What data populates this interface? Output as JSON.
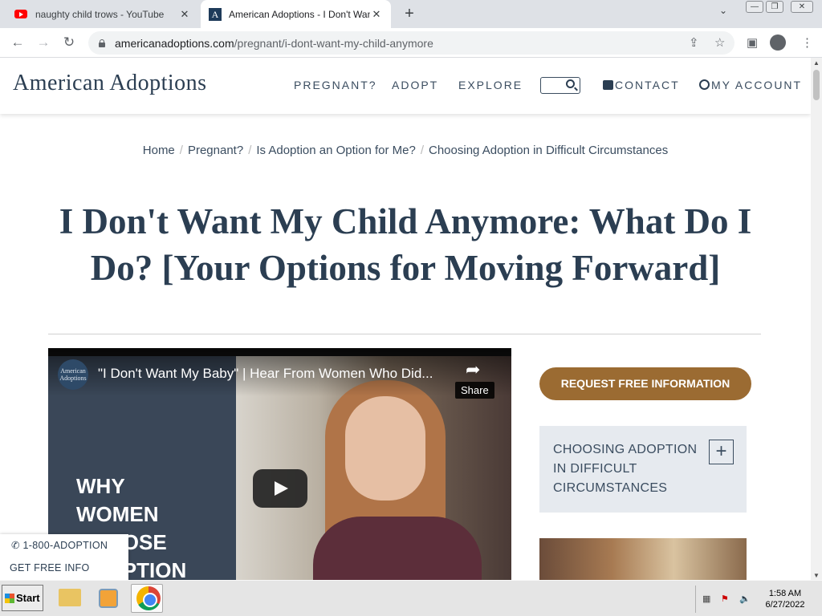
{
  "browser": {
    "tabs": [
      {
        "title": "naughty child trows - YouTube",
        "active": false
      },
      {
        "title": "American Adoptions - I Don't Want My Child Anymore",
        "active": true
      }
    ],
    "new_tab_symbol": "+",
    "url_domain": "americanadoptions.com",
    "url_path": "/pregnant/i-dont-want-my-child-anymore",
    "icons": [
      "back-icon",
      "forward-icon",
      "reload-icon",
      "lock-icon",
      "share-icon",
      "star-icon",
      "side-panel-icon",
      "profile-icon",
      "menu-icon"
    ]
  },
  "site": {
    "logo": "American Adoptions",
    "nav": {
      "pregnant": "PREGNANT?",
      "adopt": "ADOPT",
      "explore": "EXPLORE",
      "contact": "CONTACT",
      "account": "MY ACCOUNT"
    }
  },
  "breadcrumb": [
    "Home",
    "Pregnant?",
    "Is Adoption an Option for Me?",
    "Choosing Adoption in Difficult Circumstances"
  ],
  "page_title": "I Don't Want My Child Anymore: What Do I Do? [Your Options for Moving Forward]",
  "video": {
    "channel_logo": "American Adoptions",
    "title": "\"I Don't Want My Baby\" | Hear From Women Who Did...",
    "share_label": "Share",
    "overlay_lines": [
      "WHY",
      "WOMEN",
      "CHOOSE",
      "ADOPTION"
    ]
  },
  "sidebar": {
    "cta": "REQUEST FREE INFORMATION",
    "accordion_label": "CHOOSING ADOPTION IN DIFFICULT CIRCUMSTANCES",
    "accordion_toggle": "+"
  },
  "sticky": {
    "phone": "1-800-ADOPTION",
    "free_info": "GET FREE INFO"
  },
  "taskbar": {
    "start": "Start",
    "time": "1:58 AM",
    "date": "6/27/2022"
  },
  "colors": {
    "brand_navy": "#2b3e52",
    "cta_brown": "#9b6b32",
    "accordion_bg": "#e6eaef"
  }
}
